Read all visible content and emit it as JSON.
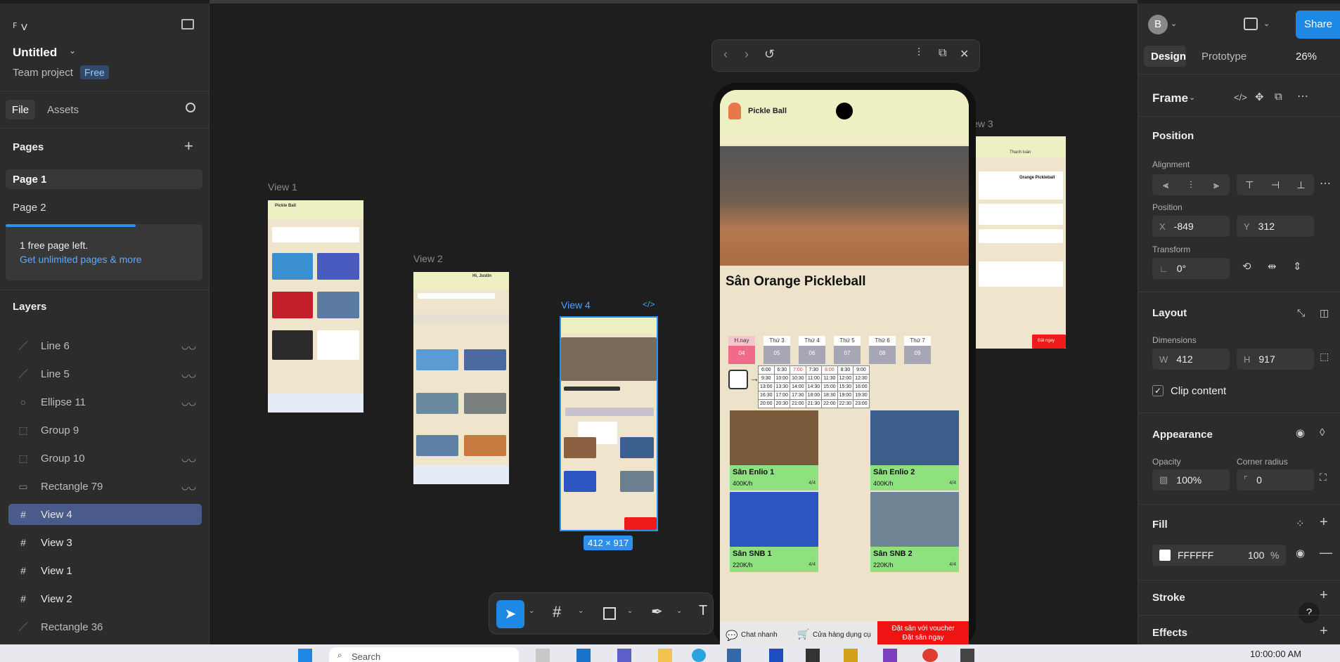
{
  "left_panel": {
    "file_title": "Untitled",
    "team": "Team project",
    "plan_badge": "Free",
    "tabs": [
      "File",
      "Assets"
    ],
    "pages_heading": "Pages",
    "pages": [
      "Page 1",
      "Page 2"
    ],
    "free_page_note": "1 free page left.",
    "upgrade_link": "Get unlimited pages & more",
    "layers_heading": "Layers",
    "layers": [
      {
        "name": "Line 6",
        "icon": "line-icon",
        "hidden": true
      },
      {
        "name": "Line 5",
        "icon": "line-icon",
        "hidden": true
      },
      {
        "name": "Ellipse 11",
        "icon": "ellipse-icon",
        "hidden": true
      },
      {
        "name": "Group 9",
        "icon": "group-icon",
        "hidden": false
      },
      {
        "name": "Group 10",
        "icon": "group-icon",
        "hidden": true
      },
      {
        "name": "Rectangle 79",
        "icon": "rectangle-icon",
        "hidden": true
      },
      {
        "name": "View 4",
        "icon": "frame-icon",
        "hidden": false,
        "selected": true
      },
      {
        "name": "View 3",
        "icon": "frame-icon",
        "hidden": false
      },
      {
        "name": "View 1",
        "icon": "frame-icon",
        "hidden": false
      },
      {
        "name": "View 2",
        "icon": "frame-icon",
        "hidden": false
      },
      {
        "name": "Rectangle 36",
        "icon": "line-icon",
        "hidden": false
      }
    ]
  },
  "canvas": {
    "view_labels": [
      "View 1",
      "View 2",
      "View 4",
      "iew 3"
    ],
    "size_badge": "412 × 917",
    "preview_app_title": "Pickle Ball",
    "preview_heading": "Sân Orange Pickleball",
    "preview_days": [
      {
        "t": "H.nay",
        "d": "04"
      },
      {
        "t": "Thứ 3",
        "d": "05"
      },
      {
        "t": "Thứ 4",
        "d": "06"
      },
      {
        "t": "Thứ 5",
        "d": "07"
      },
      {
        "t": "Thứ 6",
        "d": "08"
      },
      {
        "t": "Thứ 7",
        "d": "09"
      }
    ],
    "time_grid": [
      [
        "6:00",
        "6:30",
        "7:00",
        "7:30",
        "8:00",
        "8:30",
        "9:00"
      ],
      [
        "9:30",
        "10:00",
        "10:30",
        "11:00",
        "11:30",
        "12:00",
        "12:30"
      ],
      [
        "13:00",
        "13:30",
        "14:00",
        "14:30",
        "15:00",
        "15:30",
        "16:00"
      ],
      [
        "16:30",
        "17:00",
        "17:30",
        "18:00",
        "18:30",
        "19:00",
        "19:30"
      ],
      [
        "20:00",
        "20:30",
        "21:00",
        "21:30",
        "22:00",
        "22:30",
        "23:00"
      ]
    ],
    "courts": [
      {
        "name": "Sân Enlio 1",
        "price": "400K/h",
        "cap": "4/4"
      },
      {
        "name": "Sân Enlio 2",
        "price": "400K/h",
        "cap": "4/4"
      },
      {
        "name": "Sân SNB 1",
        "price": "220K/h",
        "cap": "4/4"
      },
      {
        "name": "Sân SNB 2",
        "price": "220K/h",
        "cap": "4/4"
      }
    ],
    "bottom_bar": {
      "chat": "Chat nhanh",
      "shop": "Cửa hàng dụng cụ",
      "cta_line1": "Đặt sân với voucher",
      "cta_line2": "Đặt sân ngay"
    },
    "view1_title": "Pickle Ball",
    "view2_greeting": "Hi, Justin",
    "view3_title": "Thanh toán",
    "view3_court": "Orange Pickleball",
    "view3_cta": "Đặt ngay"
  },
  "right_panel": {
    "avatar_letter": "B",
    "share": "Share",
    "tabs": [
      "Design",
      "Prototype"
    ],
    "zoom": "26%",
    "frame_label": "Frame",
    "position_heading": "Position",
    "alignment_label": "Alignment",
    "position_label": "Position",
    "x_value": "-849",
    "y_value": "312",
    "transform_label": "Transform",
    "rotation": "0°",
    "layout_heading": "Layout",
    "dimensions_label": "Dimensions",
    "w_value": "412",
    "h_value": "917",
    "clip_content": "Clip content",
    "appearance_heading": "Appearance",
    "opacity_label": "Opacity",
    "opacity_value": "100%",
    "radius_label": "Corner radius",
    "radius_value": "0",
    "fill_heading": "Fill",
    "fill_hex": "FFFFFF",
    "fill_opacity": "100",
    "fill_pct": "%",
    "stroke_heading": "Stroke",
    "effects_heading": "Effects",
    "help": "?"
  },
  "taskbar": {
    "search": "Search",
    "clock": "10:00:00 AM"
  }
}
